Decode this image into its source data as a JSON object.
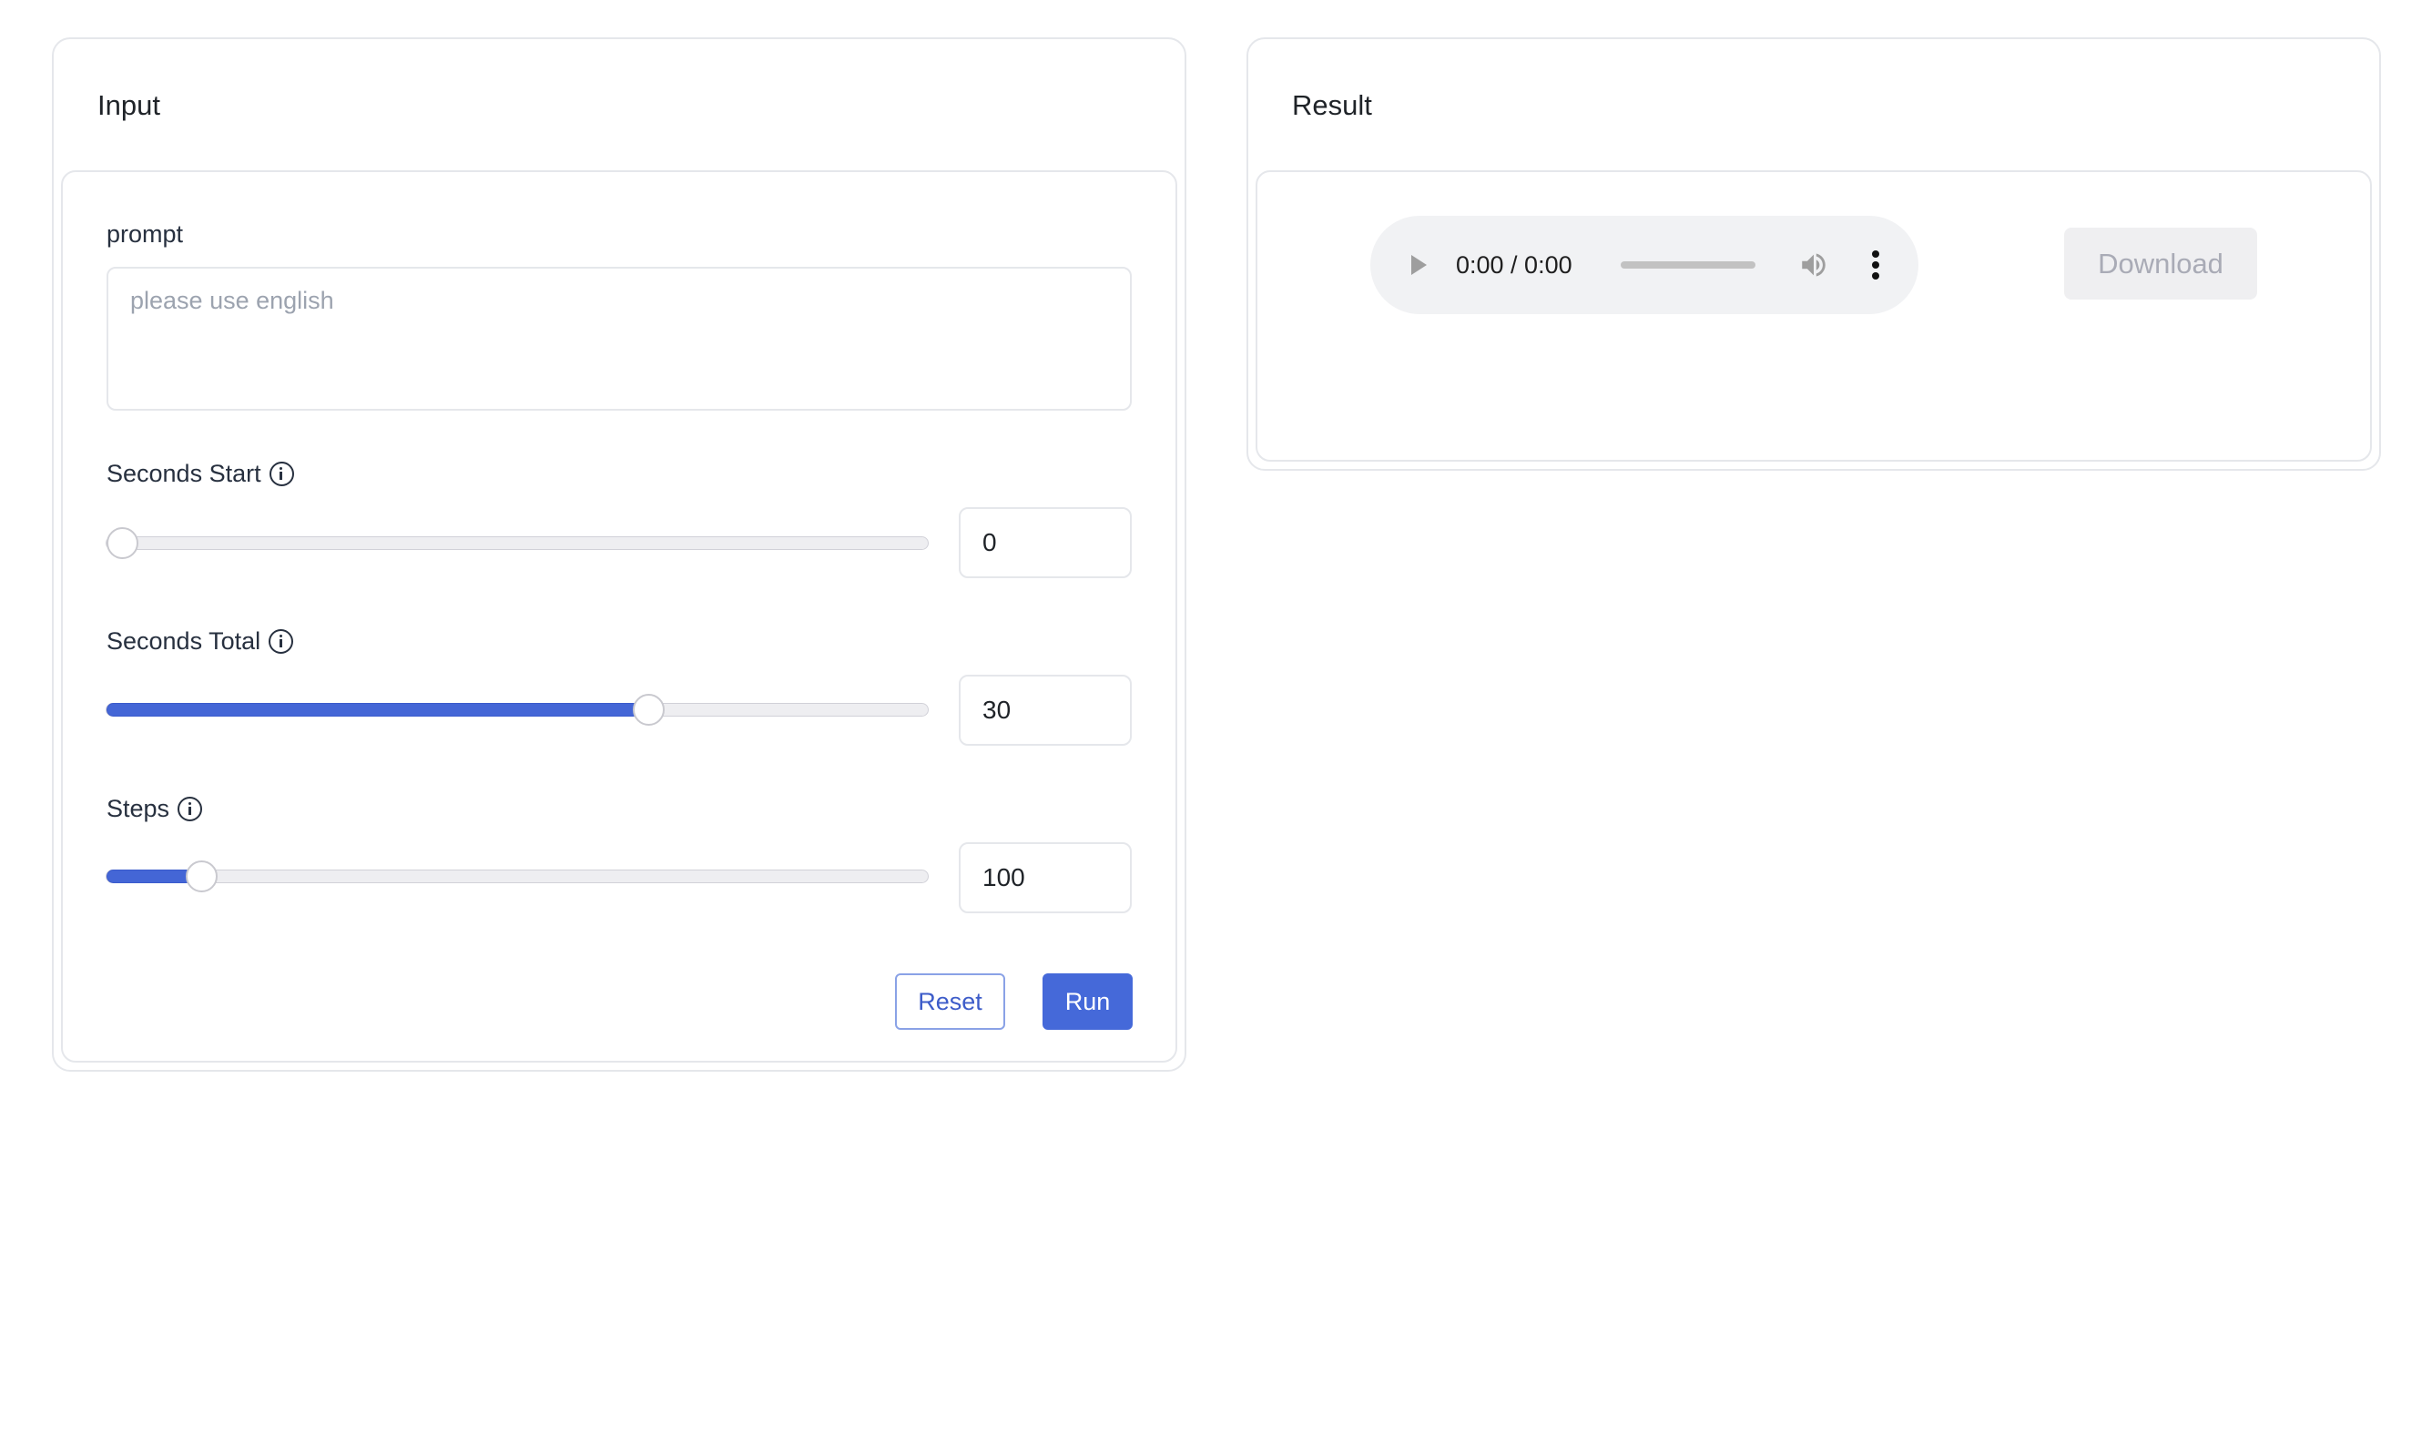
{
  "input_panel": {
    "title": "Input",
    "prompt": {
      "label": "prompt",
      "value": "",
      "placeholder": "please use english"
    },
    "sliders": [
      {
        "label": "Seconds Start",
        "info_icon": "info-circle-icon",
        "value": "0",
        "fill_fraction": 0.0
      },
      {
        "label": "Seconds Total",
        "info_icon": "info-circle-icon",
        "value": "30",
        "fill_fraction": 0.667
      },
      {
        "label": "Steps",
        "info_icon": "info-circle-icon",
        "value": "100",
        "fill_fraction": 0.1
      }
    ],
    "buttons": {
      "reset_label": "Reset",
      "run_label": "Run"
    }
  },
  "result_panel": {
    "title": "Result",
    "audio_player": {
      "play_icon": "play-icon",
      "time_display": "0:00 / 0:00",
      "progress_fraction": 0,
      "volume_icon": "volume-icon",
      "menu_icon": "more-vertical-icon"
    },
    "download_label": "Download"
  },
  "colors": {
    "accent": "#4569d9",
    "border": "#e5e7eb",
    "disabled_bg": "#efeff1",
    "disabled_text": "#a9abb6"
  }
}
